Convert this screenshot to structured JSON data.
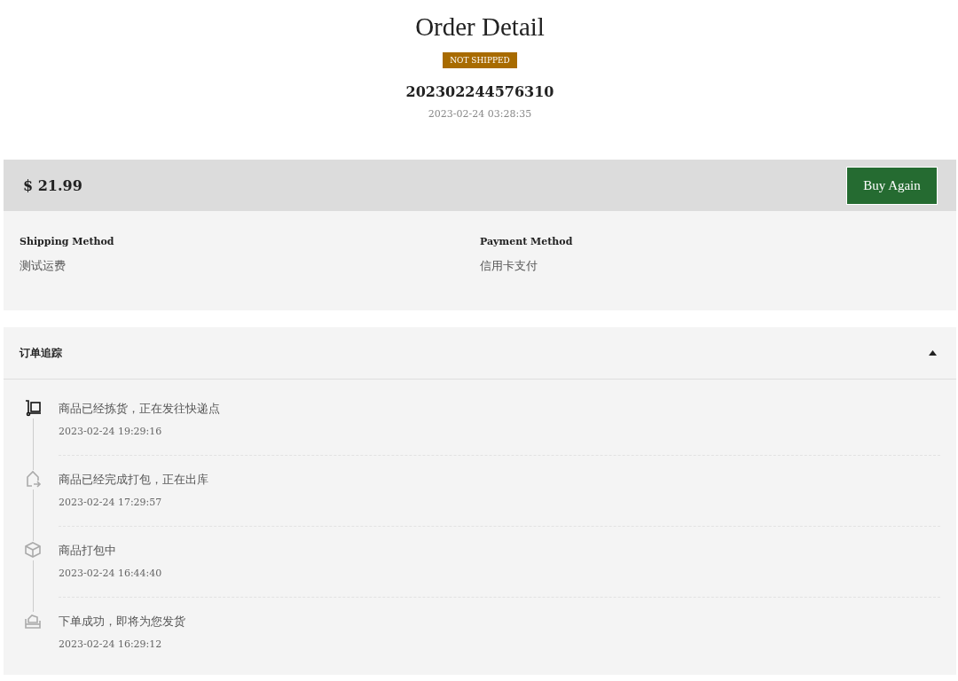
{
  "title": "Order Detail",
  "status": {
    "label": "NOT SHIPPED",
    "color": "#a86b00"
  },
  "order_number": "202302244576310",
  "order_time": "2023-02-24 03:28:35",
  "total": "$ 21.99",
  "buy_again": "Buy Again",
  "info": [
    {
      "label": "Shipping Method",
      "value": "测试运费"
    },
    {
      "label": "Payment Method",
      "value": "信用卡支付"
    }
  ],
  "tracking": {
    "title": "订单追踪",
    "expanded": true,
    "events": [
      {
        "kind": "cart",
        "active": true,
        "text": "商品已经拣货，正在发往快递点",
        "time": "2023-02-24 19:29:16"
      },
      {
        "kind": "outbound",
        "active": false,
        "text": "商品已经完成打包，正在出库",
        "time": "2023-02-24 17:29:57"
      },
      {
        "kind": "box",
        "active": false,
        "text": "商品打包中",
        "time": "2023-02-24 16:44:40"
      },
      {
        "kind": "order",
        "active": false,
        "text": "下单成功，即将为您发货",
        "time": "2023-02-24 16:29:12"
      }
    ]
  }
}
